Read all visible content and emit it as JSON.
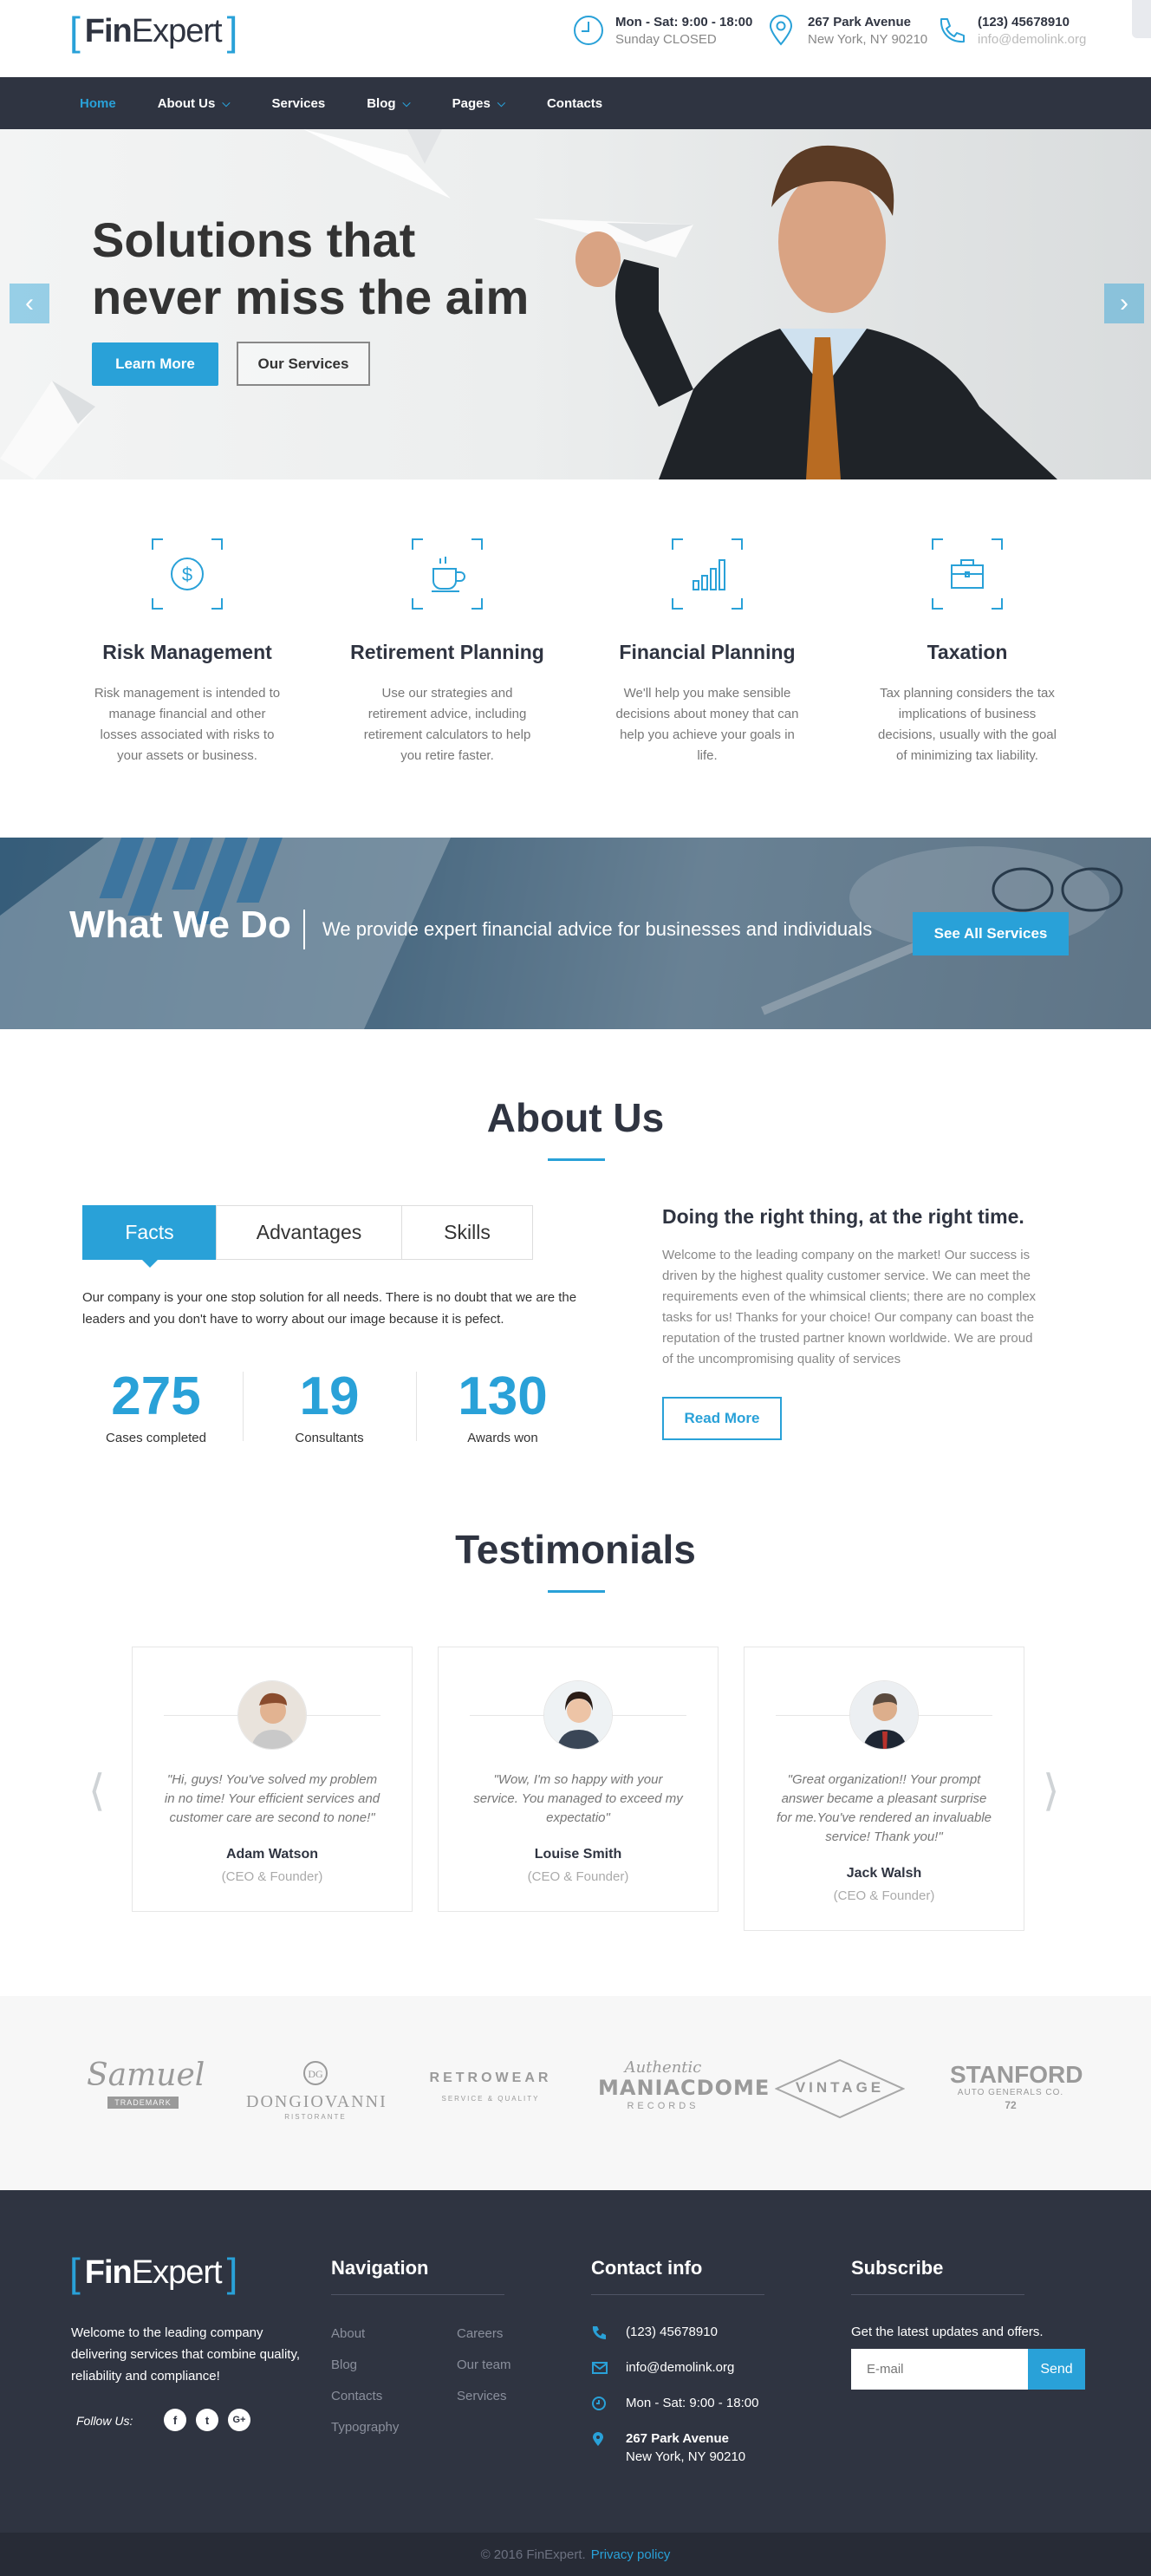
{
  "brand": {
    "logo_bold": "Fin",
    "logo_rest": "Expert",
    "accent": "#29a1d8",
    "dark": "#2f3441"
  },
  "topbar": {
    "hours": {
      "line1": "Mon - Sat: 9:00 - 18:00",
      "line2": "Sunday CLOSED",
      "icon": "clock-icon"
    },
    "address": {
      "line1": "267 Park Avenue",
      "line2": "New York, NY 90210",
      "icon": "map-pin-icon"
    },
    "phone": {
      "line1": "(123) 45678910",
      "line2": "info@demolink.org",
      "icon": "phone-icon"
    }
  },
  "nav": {
    "items": [
      {
        "label": "Home",
        "active": true
      },
      {
        "label": "About Us",
        "dropdown": true
      },
      {
        "label": "Services"
      },
      {
        "label": "Blog",
        "dropdown": true
      },
      {
        "label": "Pages",
        "dropdown": true
      },
      {
        "label": "Contacts"
      }
    ]
  },
  "hero": {
    "title_line1": "Solutions that",
    "title_line2": "never miss the aim",
    "primary_button": "Learn More",
    "secondary_button": "Our Services"
  },
  "features": [
    {
      "icon": "dollar-coin-icon",
      "title": "Risk Management",
      "text": "Risk management is intended to manage financial and other losses associated with risks to your assets or business."
    },
    {
      "icon": "coffee-cup-icon",
      "title": "Retirement Planning",
      "text": "Use our strategies and retirement advice, including retirement calculators to help you retire faster."
    },
    {
      "icon": "bar-chart-icon",
      "title": "Financial Planning",
      "text": "We'll help you make sensible decisions about money that can help you achieve your goals in life."
    },
    {
      "icon": "briefcase-icon",
      "title": "Taxation",
      "text": "Tax planning considers the tax implications of business decisions, usually with the goal of minimizing tax liability."
    }
  ],
  "what_we_do": {
    "title": "What We Do",
    "text": "We provide expert financial advice for businesses and individuals",
    "button": "See All Services"
  },
  "about": {
    "title": "About Us",
    "tabs": [
      "Facts",
      "Advantages",
      "Skills"
    ],
    "facts_text": "Our company is your one stop solution for all needs. There is no doubt that we are the leaders and you don't have to worry about our image because it is pefect.",
    "stats": [
      {
        "value": "275",
        "label": "Cases completed"
      },
      {
        "value": "19",
        "label": "Consultants"
      },
      {
        "value": "130",
        "label": "Awards won"
      }
    ],
    "heading": "Doing the right thing, at the right time.",
    "paragraph": "Welcome to the leading company on the market! Our success is driven by the highest quality customer service. We can meet the requirements even of the whimsical clients; there are no complex tasks for us! Thanks for your choice! Our company can boast the reputation of the trusted partner known worldwide. We are proud of the uncompromising quality of services",
    "button": "Read More"
  },
  "testimonials": {
    "title": "Testimonials",
    "items": [
      {
        "quote": "\"Hi, guys! You've solved my problem in no time! Your efficient services and customer care are second to none!\"",
        "name": "Adam Watson",
        "role": "(CEO & Founder)"
      },
      {
        "quote": "\"Wow, I'm so happy with your service. You managed to exceed my expectatio\"",
        "name": "Louise Smith",
        "role": "(CEO & Founder)"
      },
      {
        "quote": "\"Great organization!! Your prompt answer became a pleasant surprise for me.You've rendered an invaluable service! Thank you!\"",
        "name": "Jack Walsh",
        "role": "(CEO & Founder)"
      }
    ]
  },
  "partners": [
    {
      "main": "Samuel",
      "sub": "TRADEMARK"
    },
    {
      "main": "DONGIOVANNI",
      "sub": "RISTORANTE"
    },
    {
      "main": "RETROWEAR",
      "sub": "SERVICE & QUALITY"
    },
    {
      "main": "MANIACDOME",
      "sub": "RECORDS",
      "top": "Authentic"
    },
    {
      "main": "VINTAGE",
      "sub": ""
    },
    {
      "main": "STANFORD",
      "sub": "AUTO GENERALS CO.",
      "extra": "72"
    }
  ],
  "footer": {
    "about_text": "Welcome to the leading company delivering services that combine quality, reliability and compliance!",
    "follow_label": "Follow Us:",
    "social": [
      "f",
      "t",
      "G+"
    ],
    "nav_title": "Navigation",
    "nav_col1": [
      "About",
      "Blog",
      "Contacts",
      "Typography"
    ],
    "nav_col2": [
      "Careers",
      "Our team",
      "Services"
    ],
    "contact_title": "Contact info",
    "contact": {
      "phone": "(123) 45678910",
      "email": "info@demolink.org",
      "hours": "Mon - Sat: 9:00 - 18:00",
      "address1": "267 Park Avenue",
      "address2": "New York, NY 90210"
    },
    "subscribe_title": "Subscribe",
    "subscribe_text": "Get the latest updates and offers.",
    "email_placeholder": "E-mail",
    "send_button": "Send",
    "copyright": "© 2016 FinExpert.",
    "privacy": "Privacy policy"
  }
}
